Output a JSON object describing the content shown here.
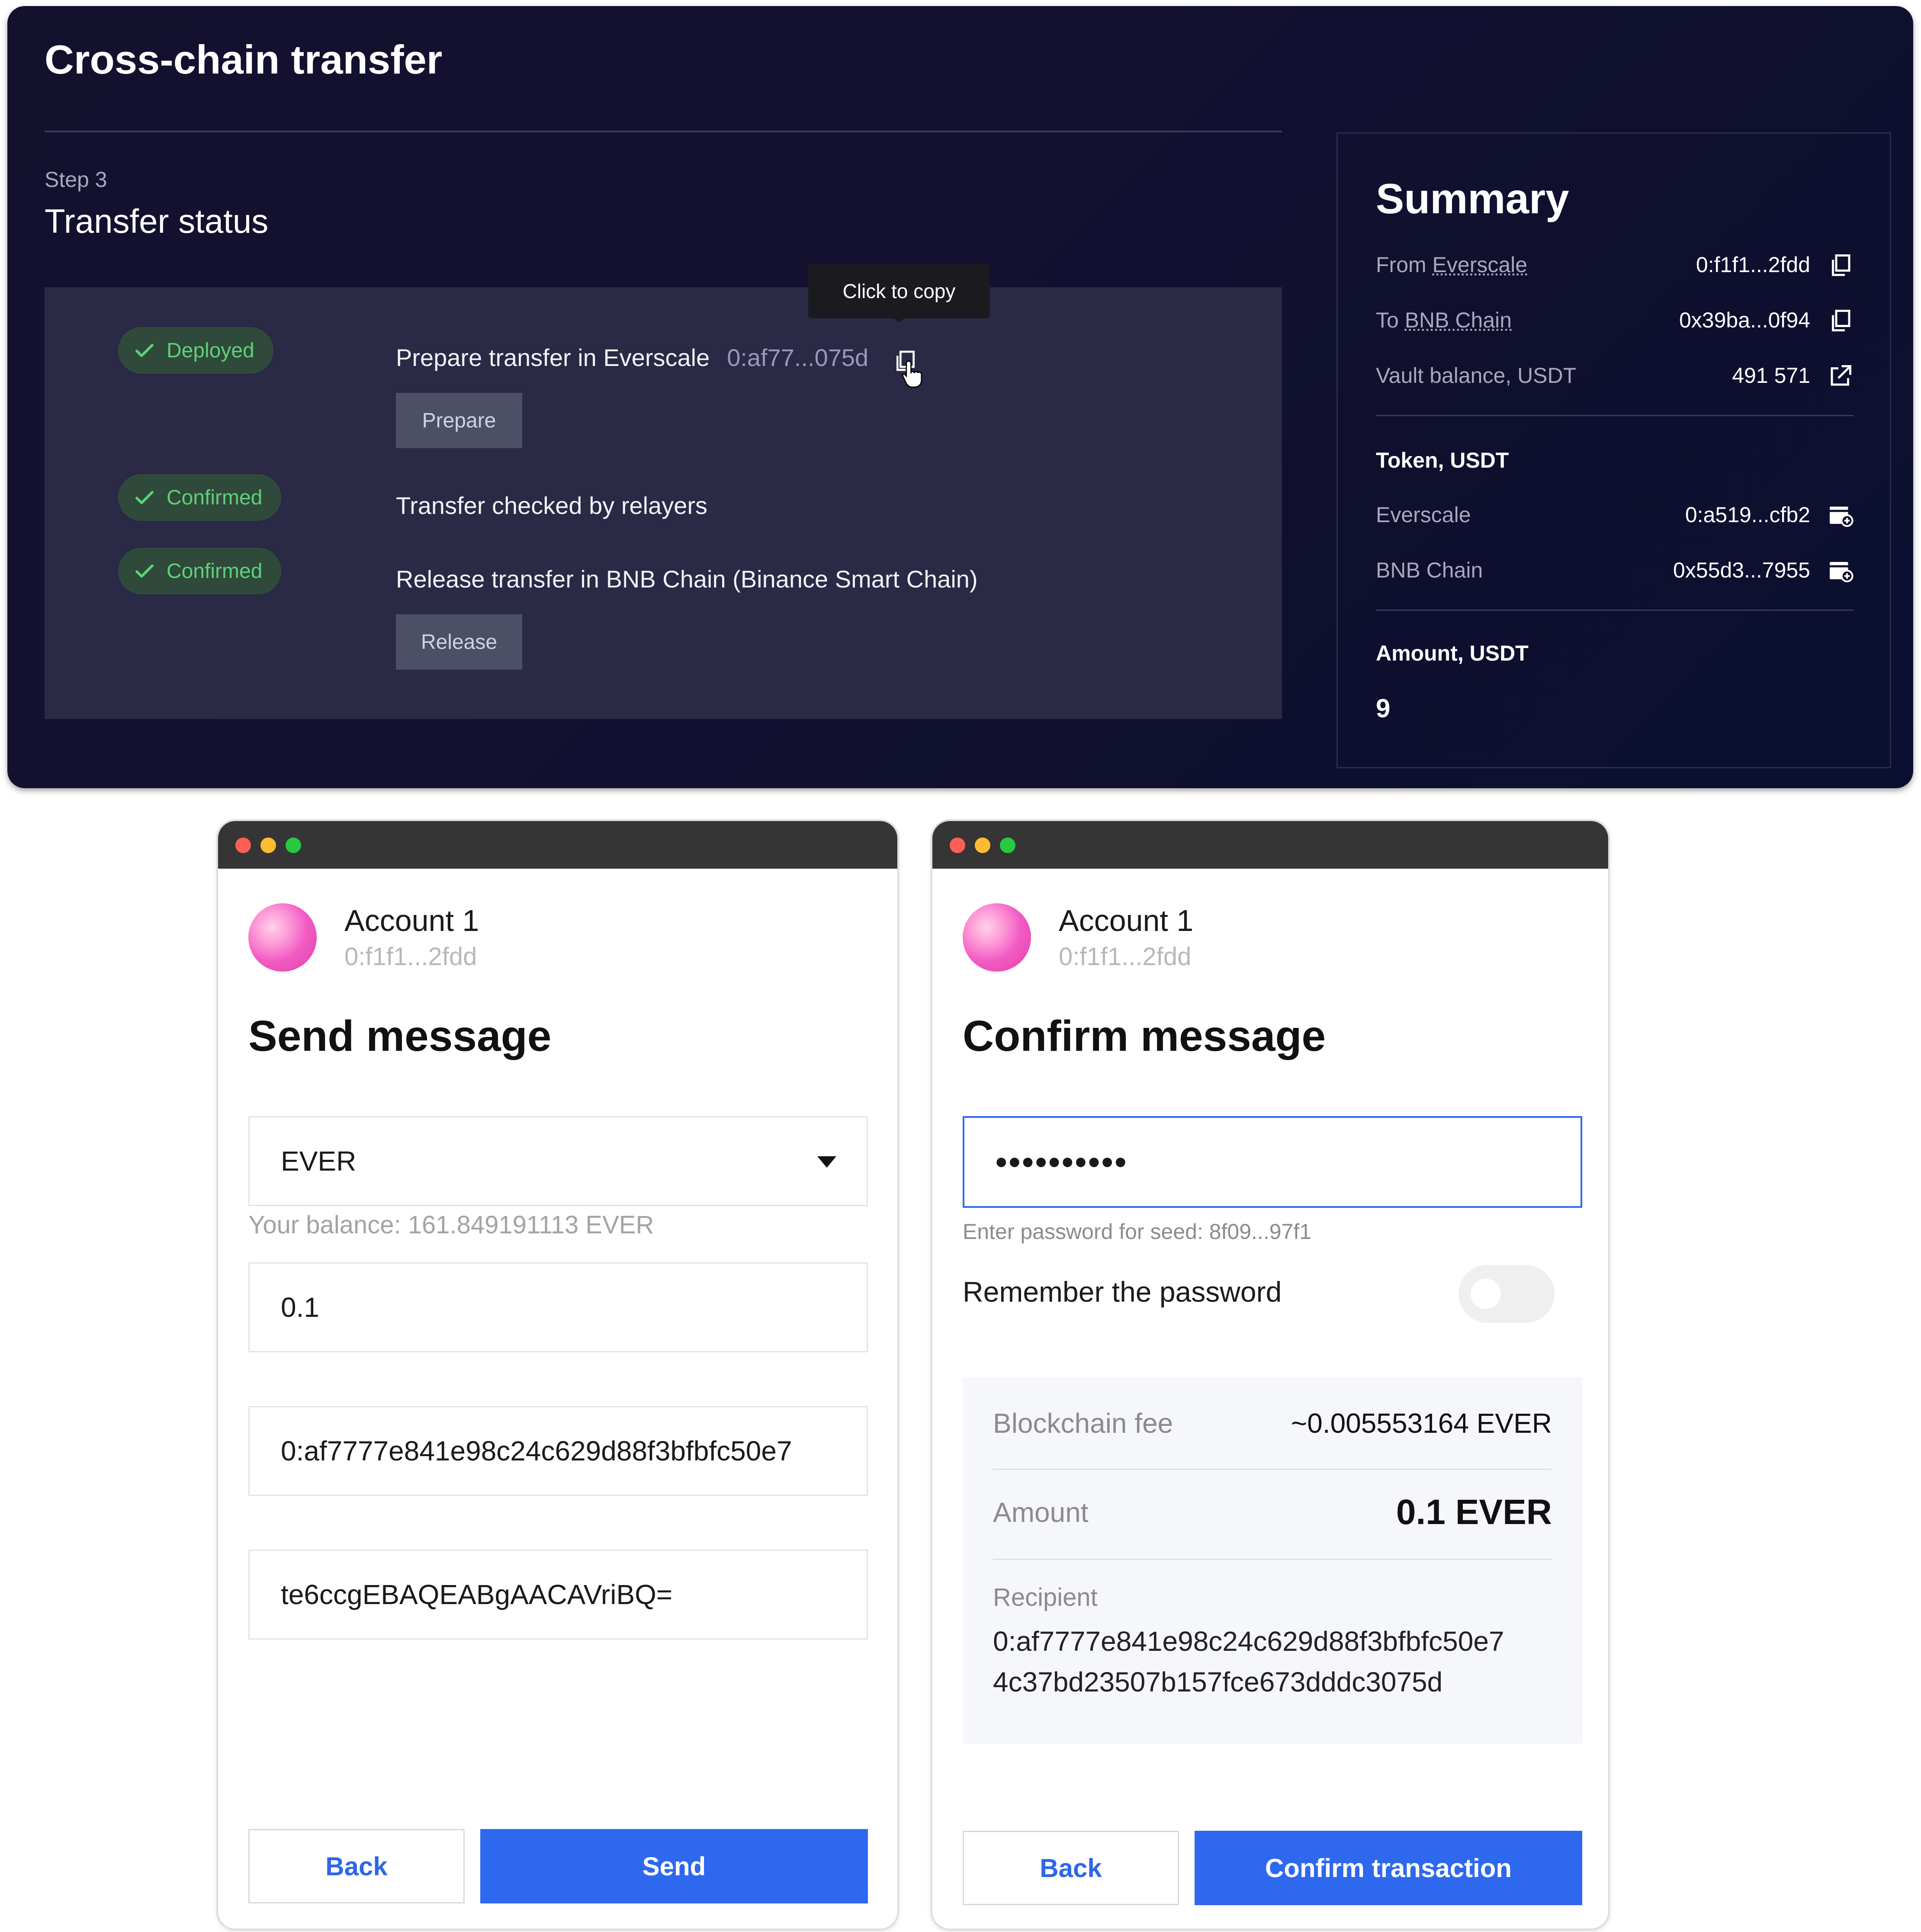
{
  "transfer": {
    "title": "Cross-chain transfer",
    "step": "Step 3",
    "status_title": "Transfer status",
    "steps": [
      {
        "badge": "Deployed",
        "text": "Prepare transfer in Everscale",
        "address": "0:af77...075d",
        "button": "Prepare"
      },
      {
        "badge": "Confirmed",
        "text": "Transfer checked by relayers"
      },
      {
        "badge": "Confirmed",
        "text": "Release transfer in BNB Chain (Binance Smart Chain)",
        "button": "Release"
      }
    ],
    "tooltip": "Click to copy"
  },
  "summary": {
    "title": "Summary",
    "from_prefix": "From ",
    "from_chain": "Everscale",
    "from_value": "0:f1f1...2fdd",
    "to_prefix": "To ",
    "to_chain": "BNB Chain",
    "to_value": "0x39ba...0f94",
    "vault_label": "Vault balance, USDT",
    "vault_value": "491 571",
    "token_head": "Token, USDT",
    "token_rows": [
      {
        "label": "Everscale",
        "value": "0:a519...cfb2"
      },
      {
        "label": "BNB Chain",
        "value": "0x55d3...7955"
      }
    ],
    "amount_head": "Amount, USDT",
    "amount_value": "9"
  },
  "send_window": {
    "account_name": "Account 1",
    "account_address": "0:f1f1...2fdd",
    "title": "Send message",
    "token": "EVER",
    "balance": "Your balance: 161.849191113 EVER",
    "amount": "0.1",
    "recipient": "0:af7777e841e98c24c629d88f3bfbfc50e7",
    "comment": "te6ccgEBAQEABgAACAVriBQ=",
    "back": "Back",
    "send": "Send"
  },
  "confirm_window": {
    "account_name": "Account 1",
    "account_address": "0:f1f1...2fdd",
    "title": "Confirm message",
    "password": "••••••••••",
    "password_hint": "Enter password for seed: 8f09...97f1",
    "remember": "Remember the password",
    "fee_label": "Blockchain fee",
    "fee_value": "~0.005553164 EVER",
    "amount_label": "Amount",
    "amount_value": "0.1 EVER",
    "recipient_label": "Recipient",
    "recipient_line1": "0:af7777e841e98c24c629d88f3bfbfc50e7",
    "recipient_line2": "4c37bd23507b157fce673dddc3075d",
    "back": "Back",
    "confirm": "Confirm transaction"
  },
  "colors": {
    "accent": "#2e68ee",
    "success": "#5fd07a",
    "panel": "#13112e"
  }
}
